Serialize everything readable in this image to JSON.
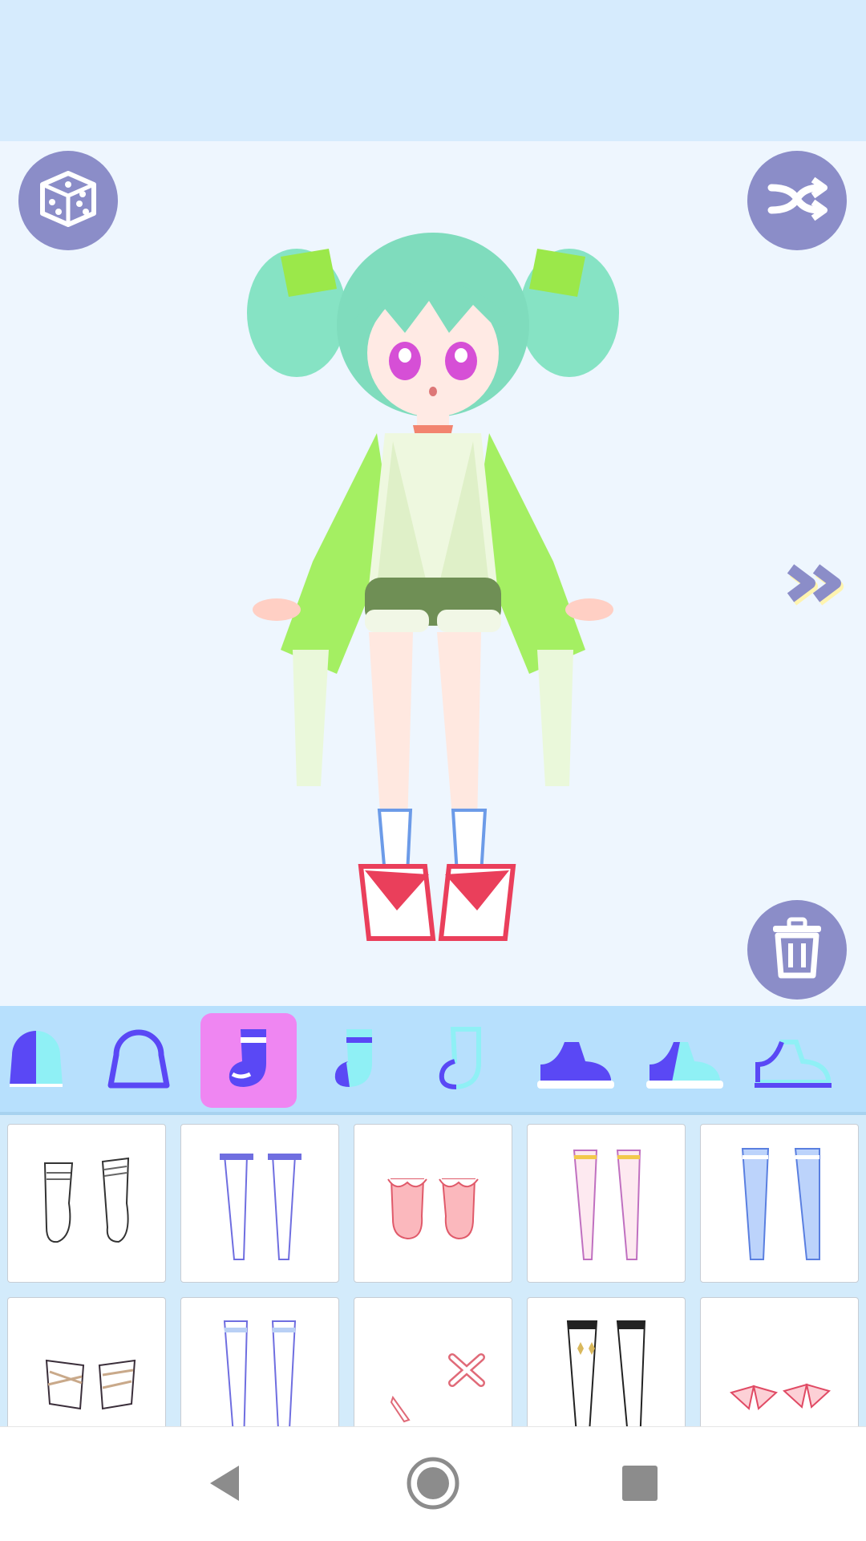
{
  "colors": {
    "top_bar": "#d6ebfd",
    "stage_background": "#eef6fe",
    "round_button": "#8b8dc8",
    "category_bar": "#b7e0fd",
    "selected_tab": "#ef86f2",
    "icon_accent": "#5a48f5",
    "icon_light": "#8ff0f5",
    "grid_background": "#d3ebfb",
    "nav_icon": "#8c8c8c"
  },
  "toolbar": {
    "dice": {
      "icon": "dice-icon"
    },
    "shuffle": {
      "icon": "shuffle-icon"
    },
    "trash": {
      "icon": "trash-icon"
    },
    "next": {
      "icon": "double-chevron-right-icon"
    }
  },
  "categories": [
    {
      "id": "skin",
      "icon": "skin-tone-icon",
      "selected": false
    },
    {
      "id": "body",
      "icon": "body-outline-icon",
      "selected": false
    },
    {
      "id": "socks-1",
      "icon": "sock-icon",
      "selected": true
    },
    {
      "id": "socks-2",
      "icon": "sock-icon",
      "selected": false
    },
    {
      "id": "socks-3",
      "icon": "sock-outline-icon",
      "selected": false
    },
    {
      "id": "shoes-1",
      "icon": "shoe-icon",
      "selected": false
    },
    {
      "id": "shoes-2",
      "icon": "shoe-icon",
      "selected": false
    },
    {
      "id": "shoes-3",
      "icon": "shoe-outline-icon",
      "selected": false
    }
  ],
  "items": [
    {
      "name": "white-slouch-socks"
    },
    {
      "name": "garter-stockings-white"
    },
    {
      "name": "pink-frill-socks"
    },
    {
      "name": "pink-thigh-highs-gold-stripe"
    },
    {
      "name": "blue-thigh-highs"
    },
    {
      "name": "leg-wraps"
    },
    {
      "name": "garter-stockings-lace"
    },
    {
      "name": "bandage-patches"
    },
    {
      "name": "white-thigh-highs-black-trim"
    },
    {
      "name": "pink-ribbon-bows"
    }
  ],
  "navigation": {
    "back": {
      "icon": "back-triangle-icon"
    },
    "home": {
      "icon": "home-circle-icon"
    },
    "recents": {
      "icon": "recents-square-icon"
    }
  }
}
